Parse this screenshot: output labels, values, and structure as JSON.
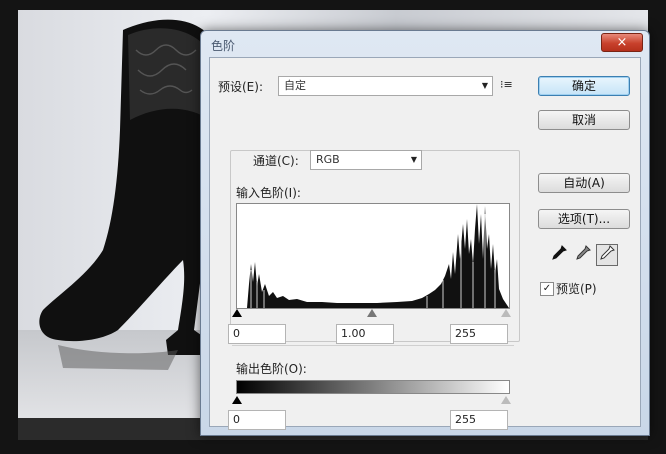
{
  "dialog": {
    "title": "色阶",
    "close_glyph": "×"
  },
  "preset": {
    "label": "预设(E):",
    "value": "自定",
    "menu_glyph": "⁝≡"
  },
  "channel": {
    "label": "通道(C):",
    "value": "RGB"
  },
  "input_levels": {
    "label": "输入色阶(I):",
    "black": "0",
    "gamma": "1.00",
    "white": "255"
  },
  "output_levels": {
    "label": "输出色阶(O):",
    "black": "0",
    "white": "255"
  },
  "buttons": {
    "ok": "确定",
    "cancel": "取消",
    "auto": "自动(A)",
    "options": "选项(T)..."
  },
  "preview": {
    "label": "预览(P)",
    "checked": true
  },
  "icons": {
    "black_eyedropper": "black-eyedropper-icon",
    "gray_eyedropper": "gray-eyedropper-icon",
    "white_eyedropper": "white-eyedropper-icon"
  }
}
